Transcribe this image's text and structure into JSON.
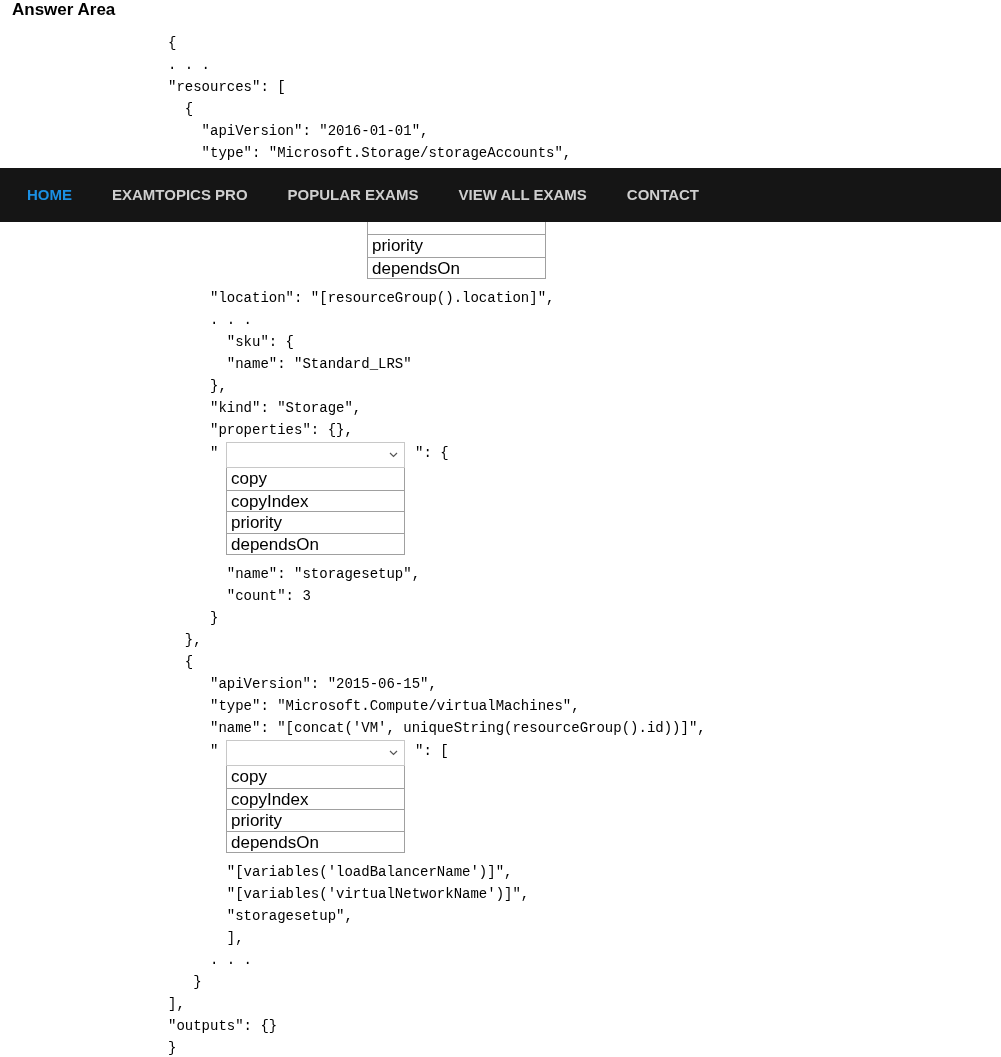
{
  "heading": "Answer Area",
  "nav": [
    {
      "label": "HOME",
      "selected": true
    },
    {
      "label": "EXAMTOPICS PRO",
      "selected": false
    },
    {
      "label": "POPULAR EXAMS",
      "selected": false
    },
    {
      "label": "VIEW ALL EXAMS",
      "selected": false
    },
    {
      "label": "CONTACT",
      "selected": false
    }
  ],
  "code": [
    {
      "kind": "line",
      "text": "{"
    },
    {
      "kind": "line",
      "text": ". . ."
    },
    {
      "kind": "line",
      "text": "\"resources\": ["
    },
    {
      "kind": "line",
      "text": "  {"
    },
    {
      "kind": "line",
      "text": "    \"apiVersion\": \"2016-01-01\","
    },
    {
      "kind": "line",
      "text": "    \"type\": \"Microsoft.Storage/storageAccounts\","
    },
    {
      "kind": "covered-list",
      "options": [
        "priority",
        "dependsOn"
      ]
    },
    {
      "kind": "line",
      "text": "     \"location\": \"[resourceGroup().location]\","
    },
    {
      "kind": "line",
      "text": "     . . ."
    },
    {
      "kind": "line",
      "text": "       \"sku\": {"
    },
    {
      "kind": "line",
      "text": "       \"name\": \"Standard_LRS\""
    },
    {
      "kind": "line",
      "text": "     },"
    },
    {
      "kind": "line",
      "text": "     \"kind\": \"Storage\","
    },
    {
      "kind": "line",
      "text": "     \"properties\": {},"
    },
    {
      "kind": "dropdown",
      "prefix": "\"",
      "suffix": "\": {",
      "options": [
        "copy",
        "copyIndex",
        "priority",
        "dependsOn"
      ]
    },
    {
      "kind": "line",
      "text": "       \"name\": \"storagesetup\","
    },
    {
      "kind": "line",
      "text": "       \"count\": 3"
    },
    {
      "kind": "line",
      "text": "     }"
    },
    {
      "kind": "line",
      "text": "  },"
    },
    {
      "kind": "line",
      "text": "  {"
    },
    {
      "kind": "line",
      "text": "     \"apiVersion\": \"2015-06-15\","
    },
    {
      "kind": "line",
      "text": "     \"type\": \"Microsoft.Compute/virtualMachines\","
    },
    {
      "kind": "line",
      "text": "     \"name\": \"[concat('VM', uniqueString(resourceGroup().id))]\","
    },
    {
      "kind": "dropdown",
      "prefix": "\"",
      "suffix": "\": [",
      "options": [
        "copy",
        "copyIndex",
        "priority",
        "dependsOn"
      ]
    },
    {
      "kind": "line",
      "text": "       \"[variables('loadBalancerName')]\","
    },
    {
      "kind": "line",
      "text": "       \"[variables('virtualNetworkName')]\","
    },
    {
      "kind": "line",
      "text": "       \"storagesetup\","
    },
    {
      "kind": "line",
      "text": "       ],"
    },
    {
      "kind": "line",
      "text": "     . . ."
    },
    {
      "kind": "line",
      "text": "   }"
    },
    {
      "kind": "line",
      "text": "],"
    },
    {
      "kind": "line",
      "text": "\"outputs\": {}"
    },
    {
      "kind": "line",
      "text": "}"
    }
  ]
}
